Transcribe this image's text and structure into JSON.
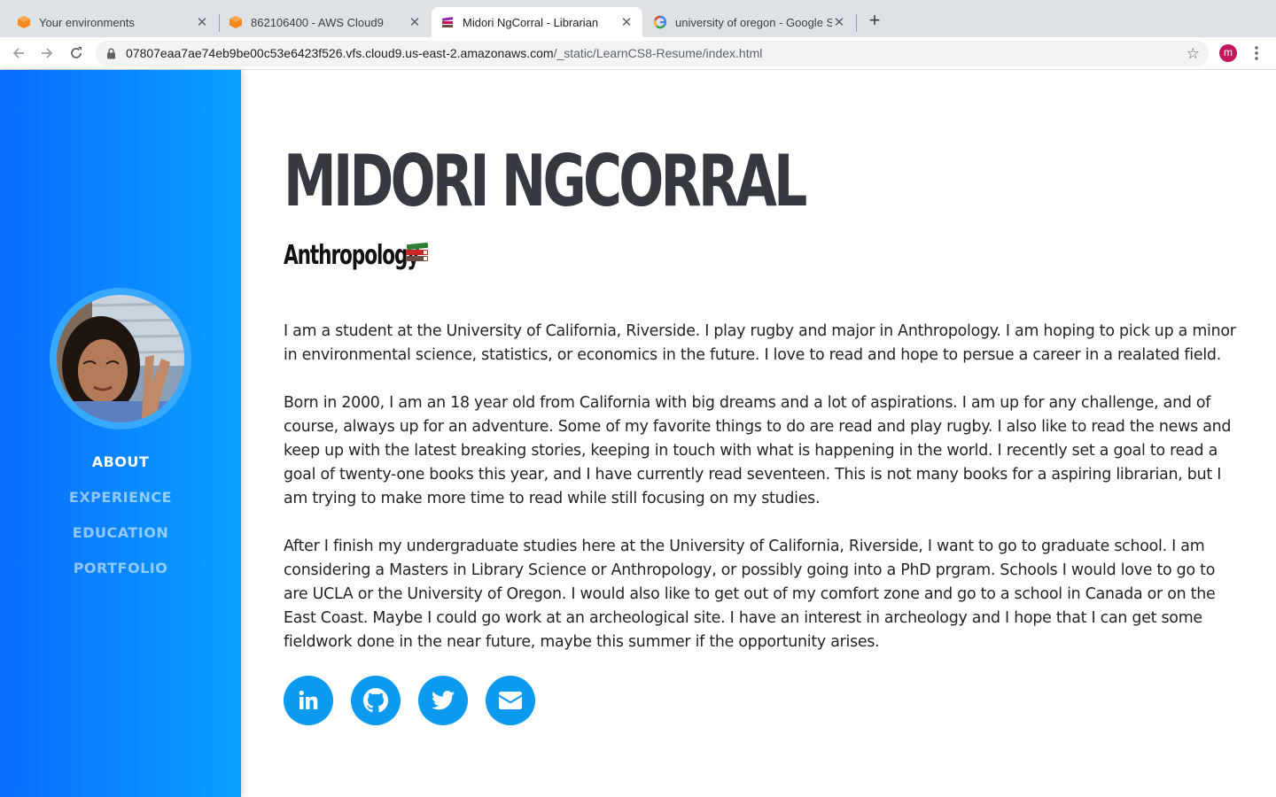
{
  "browser": {
    "tabs": [
      {
        "title": "Your environments",
        "icon": "aws-cube-icon"
      },
      {
        "title": "862106400 - AWS Cloud9",
        "icon": "aws-cube-icon"
      },
      {
        "title": "Midori NgCorral - Librarian",
        "icon": "books-icon",
        "active": true
      },
      {
        "title": "university of oregon - Google S",
        "icon": "google-icon"
      }
    ],
    "url_host": "07807eaa7ae74eb9be00c53e6423f526.vfs.cloud9.us-east-2.amazonaws.com",
    "url_path": "/_static/LearnCS8-Resume/index.html",
    "profile_initial": "m"
  },
  "sidebar": {
    "nav": [
      {
        "label": "ABOUT",
        "active": true
      },
      {
        "label": "EXPERIENCE"
      },
      {
        "label": "EDUCATION"
      },
      {
        "label": "PORTFOLIO"
      }
    ]
  },
  "main": {
    "name": "MIDORI NGCORRAL",
    "subtitle": "Anthropology",
    "paragraphs": [
      "I am a student at the University of California, Riverside. I play rugby and major in Anthropology. I am hoping to pick up a minor in environmental science, statistics, or economics in the future. I love to read and hope to persue a career in a realated field.",
      "Born in 2000, I am an 18 year old from California with big dreams and a lot of aspirations. I am up for any challenge, and of course, always up for an adventure. Some of my favorite things to do are read and play rugby. I also like to read the news and keep up with the latest breaking stories, keeping in touch with what is happening in the world. I recently set a goal to read a goal of twenty-one books this year, and I have currently read seventeen. This is not many books for a aspiring librarian, but I am trying to make more time to read while still focusing on my studies.",
      "After I finish my undergraduate studies here at the University of California, Riverside, I want to go to graduate school. I am considering a Masters in Library Science or Anthropology, or possibly going into a PhD prgram. Schools I would love to go to are UCLA or the University of Oregon. I would also like to get out of my comfort zone and go to a school in Canada or on the East Coast. Maybe I could go work at an archeological site. I have an interest in archeology and I hope that I can get some fieldwork done in the near future, maybe this summer if the opportunity arises."
    ],
    "social_icons": [
      "linkedin-icon",
      "github-icon",
      "twitter-icon",
      "envelope-icon"
    ]
  },
  "colors": {
    "sidebar_start": "#0a6cff",
    "sidebar_end": "#0aa1ff",
    "social": "#0a9bf0",
    "heading": "#343a40"
  }
}
